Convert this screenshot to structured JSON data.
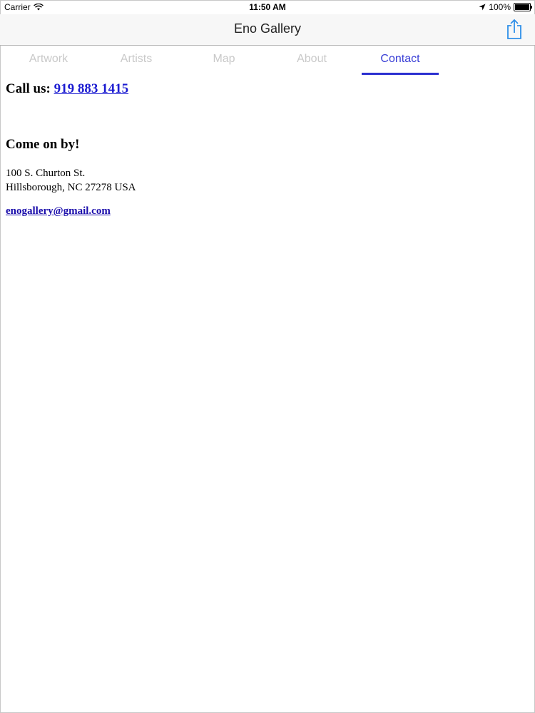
{
  "status_bar": {
    "carrier": "Carrier",
    "time": "11:50 AM",
    "battery": "100%"
  },
  "nav": {
    "title": "Eno Gallery"
  },
  "tabs": [
    {
      "label": "Artwork"
    },
    {
      "label": "Artists"
    },
    {
      "label": "Map"
    },
    {
      "label": "About"
    },
    {
      "label": "Contact"
    }
  ],
  "active_tab": "Contact",
  "contact": {
    "call_label": "Call us:",
    "phone": "919 883 1415",
    "visit_heading": "Come on by!",
    "address_line1": "100 S. Churton St.",
    "address_line2": "Hillsborough, NC 27278 USA",
    "email": "enogallery@gmail.com"
  },
  "colors": {
    "accent": "#2b2fd0",
    "link": "#1c1cd1",
    "inactive_tab": "#c9c9c9"
  }
}
